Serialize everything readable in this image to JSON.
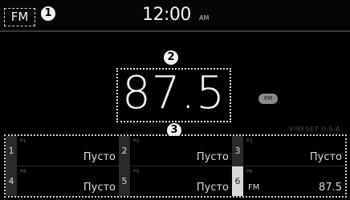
{
  "header": {
    "band": "FM",
    "time": "12:00",
    "ampm": "AM"
  },
  "callouts": {
    "c1": "1",
    "c2": "2",
    "c3": "3"
  },
  "main": {
    "frequency": "87.5",
    "badge": "FM",
    "region": "VIRESET U.S.A."
  },
  "presets": [
    {
      "number": "1",
      "label": "P1",
      "value": "Пусто"
    },
    {
      "number": "2",
      "label": "P2",
      "value": "Пусто"
    },
    {
      "number": "3",
      "label": "P3",
      "value": "Пусто"
    },
    {
      "number": "4",
      "label": "P4",
      "value": "Пусто"
    },
    {
      "number": "5",
      "label": "P5",
      "value": "Пусто"
    },
    {
      "number": "6",
      "label": "P6",
      "band": "FM",
      "value": "87.5",
      "active": true
    }
  ],
  "colors": {
    "background": "#000000",
    "text": "#e8e8e8",
    "preset_number_bg": "#2a2a2a",
    "preset_active_bg": "#d9d9d9"
  }
}
